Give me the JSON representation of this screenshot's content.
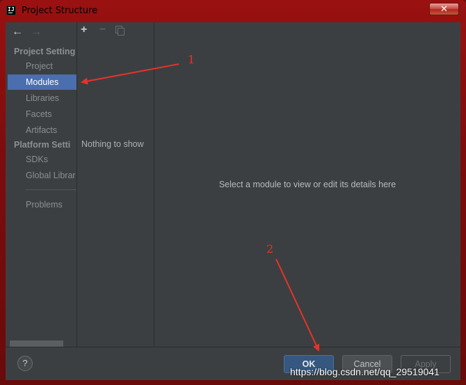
{
  "window": {
    "title": "Project Structure",
    "icon_label": "IJ",
    "close_glyph": "✕"
  },
  "nav": {
    "back_arrow": "←",
    "forward_arrow": "→",
    "project_settings_header": "Project Setting",
    "platform_settings_header": "Platform Setti",
    "project_settings_items": [
      {
        "label": "Project"
      },
      {
        "label": "Modules",
        "selected": true
      },
      {
        "label": "Libraries"
      },
      {
        "label": "Facets"
      },
      {
        "label": "Artifacts"
      }
    ],
    "platform_settings_items": [
      {
        "label": "SDKs"
      },
      {
        "label": "Global Librar"
      }
    ],
    "problems_label": "Problems"
  },
  "toolbar": {
    "add_glyph": "+",
    "remove_glyph": "−"
  },
  "module_list": {
    "empty_text": "Nothing to show"
  },
  "detail": {
    "placeholder_text": "Select a module to view or edit its details here"
  },
  "footer": {
    "help_glyph": "?",
    "ok_label": "OK",
    "cancel_label": "Cancel",
    "apply_label": "Apply"
  },
  "annotations": {
    "label_1": "1",
    "label_2": "2",
    "color": "#e8322a"
  },
  "watermark": "https://blog.csdn.net/qq_29519041",
  "colors": {
    "titlebar_red": "#9a1111",
    "panel_bg": "#3c3f41",
    "selection_blue": "#4b6eaf",
    "ok_button": "#365880"
  }
}
